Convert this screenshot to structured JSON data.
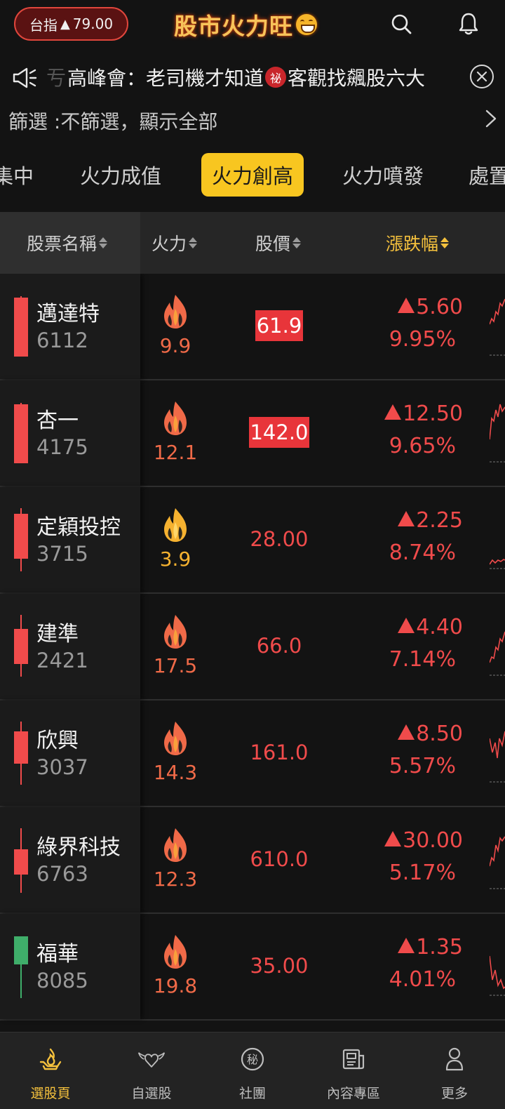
{
  "header": {
    "index_label": "台指",
    "index_arrow": "▲",
    "index_change": "79.00",
    "app_title": "股市火力旺"
  },
  "announcement": {
    "lead_fragment": "亐",
    "text_before": "高峰會：老司機才知道",
    "secret_badge": "祕",
    "text_after": "客觀找飆股六大"
  },
  "filter": {
    "label": "篩選 :不篩選，顯示全部"
  },
  "tabs": [
    {
      "label": "集中"
    },
    {
      "label": "火力成值"
    },
    {
      "label": "火力創高"
    },
    {
      "label": "火力噴發"
    },
    {
      "label": "處置"
    }
  ],
  "active_tab": "火力創高",
  "table": {
    "columns": [
      "股票名稱",
      "火力",
      "股價",
      "漲跌幅"
    ],
    "sorted_column": "漲跌幅",
    "rows": [
      {
        "name": "邁達特",
        "code": "6112",
        "fire": "9.9",
        "price": "61.9",
        "price_highlight": true,
        "change": "5.60",
        "pct": "9.95%",
        "candle": "red",
        "fire_color": "red"
      },
      {
        "name": "杏一",
        "code": "4175",
        "fire": "12.1",
        "price": "142.0",
        "price_highlight": true,
        "change": "12.50",
        "pct": "9.65%",
        "candle": "red",
        "fire_color": "red"
      },
      {
        "name": "定穎投控",
        "code": "3715",
        "fire": "3.9",
        "price": "28.00",
        "price_highlight": false,
        "change": "2.25",
        "pct": "8.74%",
        "candle": "red",
        "fire_color": "yellow"
      },
      {
        "name": "建準",
        "code": "2421",
        "fire": "17.5",
        "price": "66.0",
        "price_highlight": false,
        "change": "4.40",
        "pct": "7.14%",
        "candle": "red",
        "fire_color": "red"
      },
      {
        "name": "欣興",
        "code": "3037",
        "fire": "14.3",
        "price": "161.0",
        "price_highlight": false,
        "change": "8.50",
        "pct": "5.57%",
        "candle": "red",
        "fire_color": "red"
      },
      {
        "name": "綠界科技",
        "code": "6763",
        "fire": "12.3",
        "price": "610.0",
        "price_highlight": false,
        "change": "30.00",
        "pct": "5.17%",
        "candle": "red",
        "fire_color": "red"
      },
      {
        "name": "福華",
        "code": "8085",
        "fire": "19.8",
        "price": "35.00",
        "price_highlight": false,
        "change": "1.35",
        "pct": "4.01%",
        "candle": "green",
        "fire_color": "red"
      }
    ]
  },
  "bottom_nav": [
    {
      "label": "選股頁",
      "icon": "flame-hand-icon",
      "active": true
    },
    {
      "label": "自選股",
      "icon": "winged-heart-icon",
      "active": false
    },
    {
      "label": "社團",
      "icon": "secret-circle-icon",
      "active": false
    },
    {
      "label": "內容專區",
      "icon": "newspaper-icon",
      "active": false
    },
    {
      "label": "更多",
      "icon": "person-icon",
      "active": false
    }
  ],
  "colors": {
    "up_red": "#f04b4b",
    "accent_yellow": "#f8c620",
    "fire_orange": "#f06a48",
    "candle_green": "#3fae6a"
  }
}
